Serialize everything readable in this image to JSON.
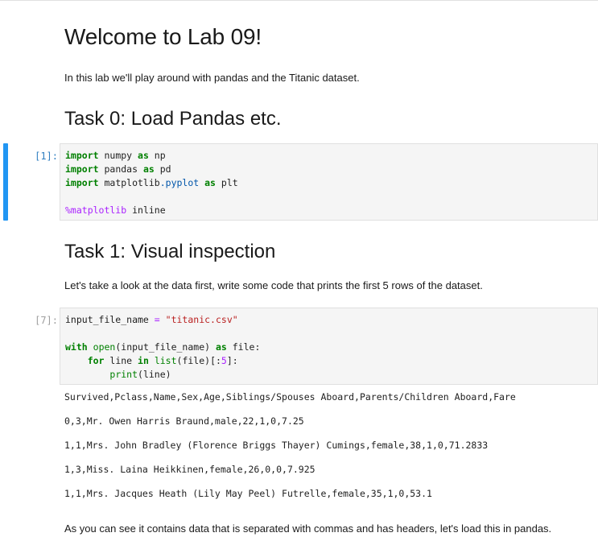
{
  "notebook": {
    "title": "Welcome to Lab 09!",
    "intro": "In this lab we'll play around with pandas and the Titanic dataset.",
    "task0": {
      "heading": "Task 0: Load Pandas etc.",
      "cell": {
        "prompt": "[1]:",
        "state": "active",
        "lines": [
          [
            {
              "t": "import",
              "c": "kw"
            },
            {
              "t": " numpy ",
              "c": ""
            },
            {
              "t": "as",
              "c": "kw"
            },
            {
              "t": " np",
              "c": ""
            }
          ],
          [
            {
              "t": "import",
              "c": "kw"
            },
            {
              "t": " pandas ",
              "c": ""
            },
            {
              "t": "as",
              "c": "kw"
            },
            {
              "t": " pd",
              "c": ""
            }
          ],
          [
            {
              "t": "import",
              "c": "kw"
            },
            {
              "t": " matplotlib",
              "c": ""
            },
            {
              "t": ".pyplot",
              "c": "mod"
            },
            {
              "t": " ",
              "c": ""
            },
            {
              "t": "as",
              "c": "kw"
            },
            {
              "t": " plt",
              "c": ""
            }
          ],
          [],
          [
            {
              "t": "%matplotlib",
              "c": "mag"
            },
            {
              "t": " inline",
              "c": ""
            }
          ]
        ]
      }
    },
    "task1": {
      "heading": "Task 1: Visual inspection",
      "description": "Let's take a look at the data first, write some code that prints the first 5 rows of the dataset.",
      "cell": {
        "prompt": "[7]:",
        "state": "idle",
        "lines": [
          [
            {
              "t": "input_file_name ",
              "c": ""
            },
            {
              "t": "=",
              "c": "op"
            },
            {
              "t": " ",
              "c": ""
            },
            {
              "t": "\"titanic.csv\"",
              "c": "str"
            }
          ],
          [],
          [
            {
              "t": "with",
              "c": "kw"
            },
            {
              "t": " ",
              "c": ""
            },
            {
              "t": "open",
              "c": "bi"
            },
            {
              "t": "(input_file_name) ",
              "c": ""
            },
            {
              "t": "as",
              "c": "kw"
            },
            {
              "t": " file:",
              "c": ""
            }
          ],
          [
            {
              "t": "    ",
              "c": ""
            },
            {
              "t": "for",
              "c": "kw"
            },
            {
              "t": " line ",
              "c": ""
            },
            {
              "t": "in",
              "c": "kw"
            },
            {
              "t": " ",
              "c": ""
            },
            {
              "t": "list",
              "c": "bi"
            },
            {
              "t": "(file)[:",
              "c": ""
            },
            {
              "t": "5",
              "c": "mag"
            },
            {
              "t": "]:",
              "c": ""
            }
          ],
          [
            {
              "t": "        ",
              "c": ""
            },
            {
              "t": "print",
              "c": "bi"
            },
            {
              "t": "(line)",
              "c": ""
            }
          ]
        ]
      },
      "output": [
        "Survived,Pclass,Name,Sex,Age,Siblings/Spouses Aboard,Parents/Children Aboard,Fare",
        "0,3,Mr. Owen Harris Braund,male,22,1,0,7.25",
        "1,1,Mrs. John Bradley (Florence Briggs Thayer) Cumings,female,38,1,0,71.2833",
        "1,3,Miss. Laina Heikkinen,female,26,0,0,7.925",
        "1,1,Mrs. Jacques Heath (Lily May Peel) Futrelle,female,35,1,0,53.1"
      ],
      "conclusion": "As you can see it contains data that is separated with commas and has headers, let's load this in pandas."
    }
  }
}
